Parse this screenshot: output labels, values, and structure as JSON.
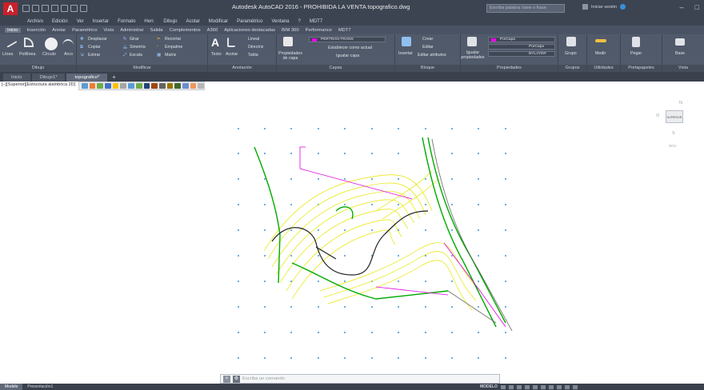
{
  "app": {
    "title": "Autodesk AutoCAD 2016 - PROHIBIDA LA VENTA    topografico.dwg",
    "search_placeholder": "Escriba palabra clave o frase",
    "signin_label": "Iniciar sesión",
    "logo_letter": "A"
  },
  "menubar": [
    "Archivo",
    "Edición",
    "Ver",
    "Insertar",
    "Formato",
    "Herr.",
    "Dibujo",
    "Acotar",
    "Modificar",
    "Paramétrico",
    "Ventana",
    "?",
    "MDT7"
  ],
  "ribbon_tabs": [
    {
      "label": "Inicio",
      "active": true
    },
    {
      "label": "Inserción"
    },
    {
      "label": "Anotar"
    },
    {
      "label": "Paramétrico"
    },
    {
      "label": "Vista"
    },
    {
      "label": "Administrar"
    },
    {
      "label": "Salida"
    },
    {
      "label": "Complementos"
    },
    {
      "label": "A360"
    },
    {
      "label": "Aplicaciones destacadas"
    },
    {
      "label": "BIM 360"
    },
    {
      "label": "Performance"
    },
    {
      "label": "MDT7"
    }
  ],
  "ribbon": {
    "dibujo": {
      "title": "Dibujo",
      "tools": [
        "Línea",
        "Polilínea",
        "Círculo",
        "Arco"
      ]
    },
    "modificar": {
      "title": "Modificar",
      "tools": [
        "Desplazar",
        "Girar",
        "Recortar",
        "Copiar",
        "Simetría",
        "Empalme",
        "Estirar",
        "Escala",
        "Matriz"
      ]
    },
    "anotacion": {
      "title": "Anotación",
      "tools": [
        "Texto",
        "Acotar",
        "Lineal",
        "Directriz",
        "Tabla"
      ]
    },
    "capas": {
      "title": "Capas",
      "tools": [
        "Propiedades de capa",
        "Establecer como actual",
        "Igualar capa"
      ],
      "current_layer": "PERTRAN-TRANS"
    },
    "bloque": {
      "title": "Bloque",
      "tools": [
        "Insertar",
        "Crear",
        "Editar",
        "Editar atributos"
      ]
    },
    "propiedades": {
      "title": "Propiedades",
      "tools": [
        "Igualar propiedades"
      ],
      "color": "PorCapa",
      "linetype": "PorCapa",
      "lineweight": "BYLAYER"
    },
    "grupos": {
      "title": "Grupos",
      "tools": [
        "Grupo"
      ]
    },
    "utilidades": {
      "title": "Utilidades",
      "tools": [
        "Medir"
      ]
    },
    "portapapeles": {
      "title": "Portapapeles",
      "tools": [
        "Pegar"
      ]
    },
    "vista": {
      "title": "Vista",
      "tools": [
        "Base"
      ]
    }
  },
  "doc_tabs": [
    {
      "label": "Inicio"
    },
    {
      "label": "Dibujo1*"
    },
    {
      "label": "topografico*",
      "active": true
    }
  ],
  "viewport_label": "[−][Superior][Estructura alámbrica 2D]",
  "viewcube": {
    "face": "SUPERIOR",
    "north": "N",
    "south": "S",
    "west": "O",
    "east": "E",
    "wcs": "SCU"
  },
  "command_line": {
    "placeholder": "Escriba un comando"
  },
  "status": {
    "tabs": [
      {
        "label": "Modelo",
        "active": true
      },
      {
        "label": "Presentación1"
      }
    ],
    "mode": "MODELO"
  },
  "colors": {
    "accent": "#c8212b",
    "magenta": "#e000e0",
    "green": "#00aa00",
    "yellow": "#e6e600",
    "grid_dot": "#0077cc"
  }
}
